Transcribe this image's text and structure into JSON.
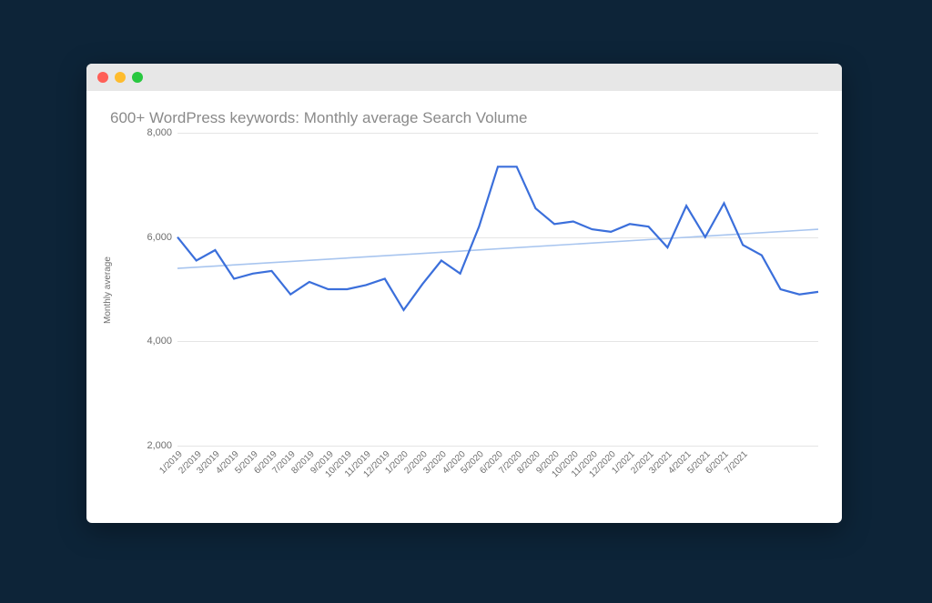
{
  "window": {
    "traffic_lights": [
      "close",
      "minimize",
      "zoom"
    ]
  },
  "chart_data": {
    "type": "line",
    "title": "600+ WordPress keywords: Monthly average Search Volume",
    "ylabel": "Monthly average",
    "xlabel": "",
    "ylim": [
      2000,
      8000
    ],
    "yticks": [
      2000,
      4000,
      6000,
      8000
    ],
    "ytick_labels": [
      "2,000",
      "4,000",
      "6,000",
      "8,000"
    ],
    "categories": [
      "1/2019",
      "2/2019",
      "3/2019",
      "4/2019",
      "5/2019",
      "6/2019",
      "7/2019",
      "8/2019",
      "9/2019",
      "10/2019",
      "11/2019",
      "12/2019",
      "1/2020",
      "2/2020",
      "3/2020",
      "4/2020",
      "5/2020",
      "6/2020",
      "7/2020",
      "8/2020",
      "9/2020",
      "10/2020",
      "11/2020",
      "12/2020",
      "1/2021",
      "2/2021",
      "3/2021",
      "4/2021",
      "5/2021",
      "6/2021",
      "7/2021"
    ],
    "series": [
      {
        "name": "Monthly average",
        "color": "#3b6fdb",
        "values": [
          6000,
          5550,
          5750,
          5200,
          5300,
          5350,
          4900,
          5140,
          5000,
          5000,
          5080,
          5200,
          4600,
          5100,
          5550,
          5300,
          6200,
          7350,
          7350,
          6550,
          6250,
          6300,
          6150,
          6100,
          6250,
          6200,
          5800,
          6600,
          6000,
          6650,
          5850,
          5650,
          5000,
          4900,
          4950
        ]
      },
      {
        "name": "Trend",
        "color": "#a8c5ef",
        "is_trendline": true,
        "values_endpoints": {
          "start": 5400,
          "end": 6150
        }
      }
    ]
  }
}
